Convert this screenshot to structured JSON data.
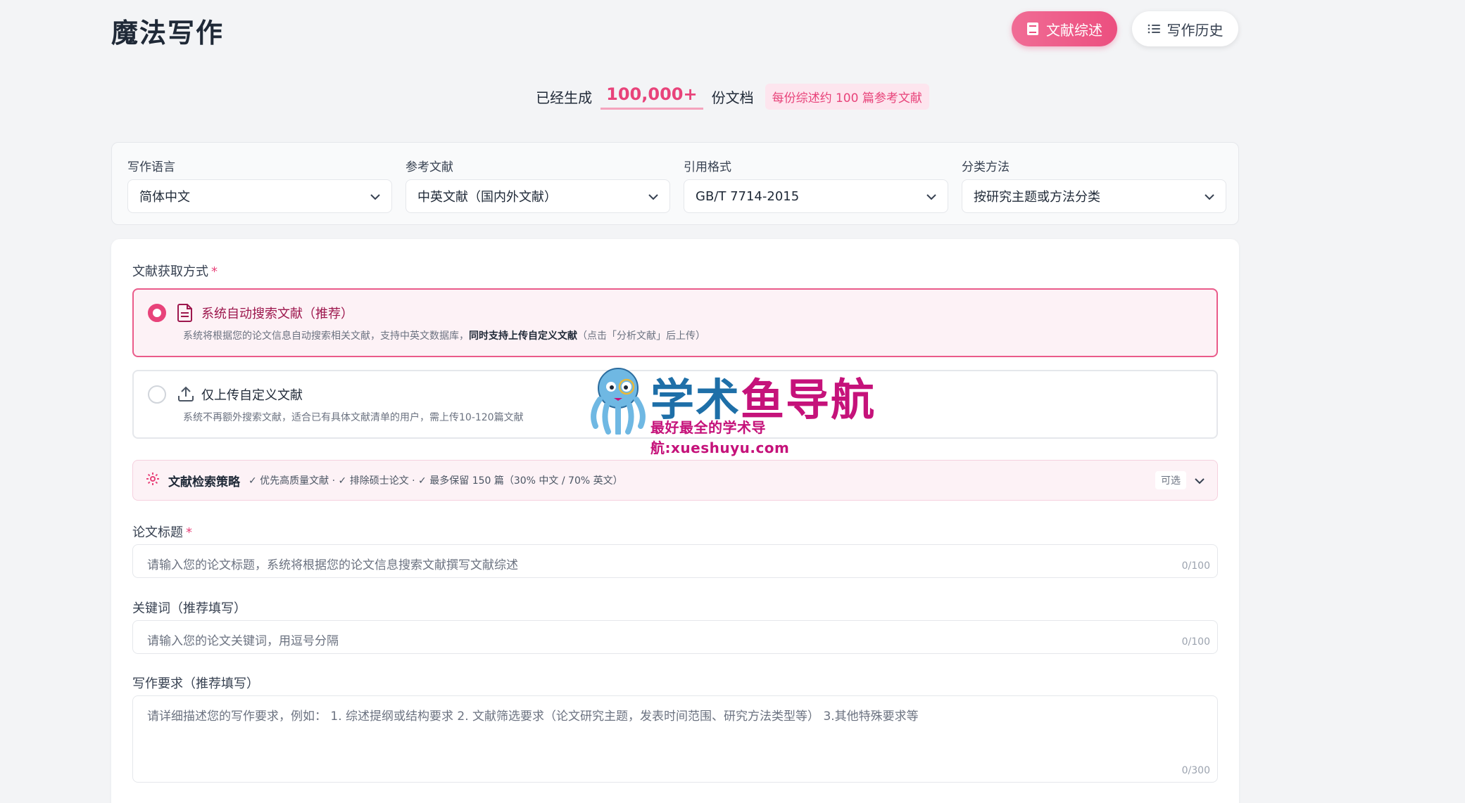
{
  "header": {
    "title": "魔法写作",
    "review_button": "文献综述",
    "history_button": "写作历史",
    "review_icon": "book-icon",
    "history_icon": "list-icon",
    "accent_color": "#ec4f7f"
  },
  "stats": {
    "prefix": "已经生成",
    "count": "100,000+",
    "suffix": "份文档",
    "badge": "每份综述约 100 篇参考文献"
  },
  "settings": {
    "language": {
      "label": "写作语言",
      "value": "简体中文"
    },
    "references": {
      "label": "参考文献",
      "value": "中英文献（国内外文献）"
    },
    "citation": {
      "label": "引用格式",
      "value": "GB/T 7714-2015"
    },
    "classification": {
      "label": "分类方法",
      "value": "按研究主题或方法分类"
    }
  },
  "acquisition": {
    "label": "文献获取方式",
    "required_mark": "*",
    "options": [
      {
        "title": "系统自动搜索文献（推荐）",
        "desc_part1": "系统将根据您的论文信息自动搜索相关文献，支持中英文数据库，",
        "desc_bold": "同时支持上传自定义文献",
        "desc_part2": "（点击「分析文献」后上传）",
        "icon": "document-icon",
        "selected": true
      },
      {
        "title": "仅上传自定义文献",
        "desc": "系统不再额外搜索文献，适合已有具体文献清单的用户，需上传10-120篇文献",
        "icon": "upload-icon",
        "selected": false
      }
    ]
  },
  "strategy": {
    "title": "文献检索策略",
    "summary": "✓ 优先高质量文献 · ✓ 排除硕士论文 · ✓ 最多保留 150 篇（30% 中文 / 70% 英文）",
    "optional": "可选",
    "icon": "gear-icon"
  },
  "title_field": {
    "label": "论文标题",
    "required_mark": "*",
    "placeholder": "请输入您的论文标题，系统将根据您的论文信息搜索文献撰写文献综述",
    "counter": "0/100"
  },
  "keywords_field": {
    "label": "关键词（推荐填写）",
    "placeholder": "请输入您的论文关键词，用逗号分隔",
    "counter": "0/100"
  },
  "requirements_field": {
    "label": "写作要求（推荐填写）",
    "placeholder": "请详细描述您的写作要求，例如： 1. 综述提纲或结构要求  2. 文献筛选要求（论文研究主题，发表时间范围、研究方法类型等） 3.其他特殊要求等",
    "counter": "0/300"
  },
  "watermark": {
    "line1_a": "学术",
    "line1_b": "鱼导航",
    "line2": "最好最全的学术导航:xueshuyu.com",
    "logo": "octopus-logo"
  }
}
